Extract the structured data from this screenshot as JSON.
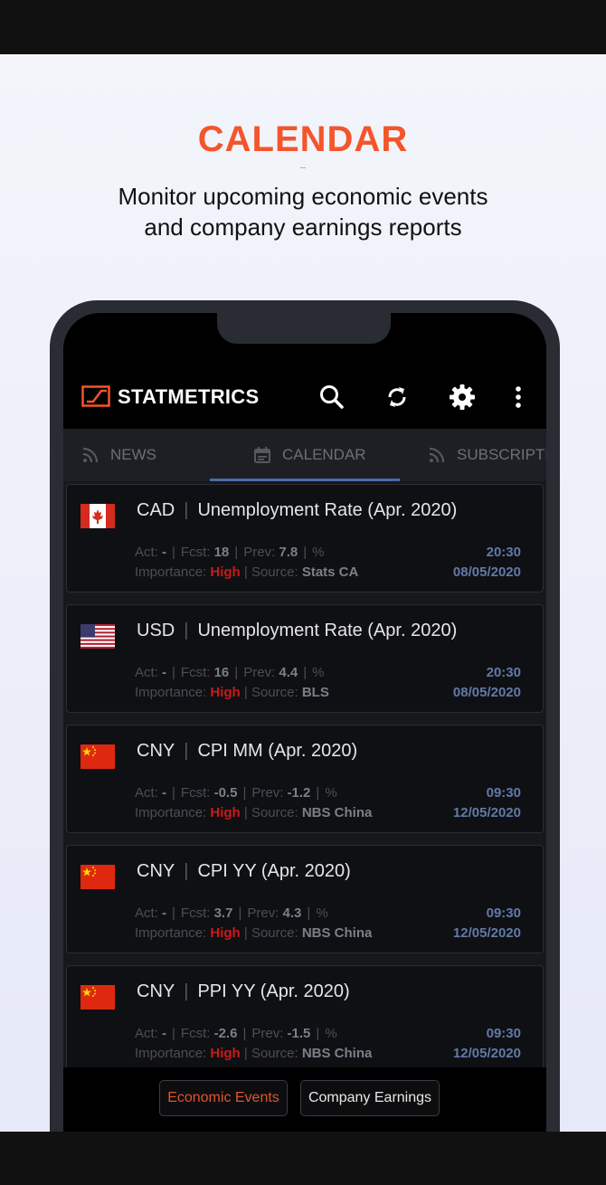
{
  "hero": {
    "title": "CALENDAR",
    "subtitle_line1": "Monitor upcoming economic events",
    "subtitle_line2": "and company earnings reports"
  },
  "app": {
    "brand": "STATMETRICS",
    "actions": [
      "search-icon",
      "refresh-icon",
      "settings-icon",
      "more-vertical-icon"
    ],
    "tabs": [
      {
        "label": "NEWS",
        "icon": "rss-icon",
        "active": false
      },
      {
        "label": "CALENDAR",
        "icon": "calendar-icon",
        "active": true
      },
      {
        "label": "SUBSCRIPTIC",
        "icon": "rss-icon",
        "active": false
      }
    ]
  },
  "labels": {
    "act": "Act:",
    "fcst": "Fcst:",
    "prev": "Prev:",
    "importance": "Importance:",
    "source": "Source:"
  },
  "events": [
    {
      "currency": "CAD",
      "title": "Unemployment Rate (Apr. 2020)",
      "act": "-",
      "fcst": "18",
      "prev": "7.8",
      "unit": "%",
      "importance": "High",
      "source": "Stats CA",
      "time": "20:30",
      "date": "08/05/2020",
      "flag": "canada"
    },
    {
      "currency": "USD",
      "title": "Unemployment Rate (Apr. 2020)",
      "act": "-",
      "fcst": "16",
      "prev": "4.4",
      "unit": "%",
      "importance": "High",
      "source": "BLS",
      "time": "20:30",
      "date": "08/05/2020",
      "flag": "usa"
    },
    {
      "currency": "CNY",
      "title": "CPI MM (Apr. 2020)",
      "act": "-",
      "fcst": "-0.5",
      "prev": "-1.2",
      "unit": "%",
      "importance": "High",
      "source": "NBS China",
      "time": "09:30",
      "date": "12/05/2020",
      "flag": "china"
    },
    {
      "currency": "CNY",
      "title": "CPI YY (Apr. 2020)",
      "act": "-",
      "fcst": "3.7",
      "prev": "4.3",
      "unit": "%",
      "importance": "High",
      "source": "NBS China",
      "time": "09:30",
      "date": "12/05/2020",
      "flag": "china"
    },
    {
      "currency": "CNY",
      "title": "PPI YY (Apr. 2020)",
      "act": "-",
      "fcst": "-2.6",
      "prev": "-1.5",
      "unit": "%",
      "importance": "High",
      "source": "NBS China",
      "time": "09:30",
      "date": "12/05/2020",
      "flag": "china"
    }
  ],
  "footer": {
    "economic_events": "Economic Events",
    "company_earnings": "Company Earnings"
  },
  "colors": {
    "accent": "#f4552b",
    "importance_high": "#c81a1a",
    "datetime": "#6279a8"
  }
}
